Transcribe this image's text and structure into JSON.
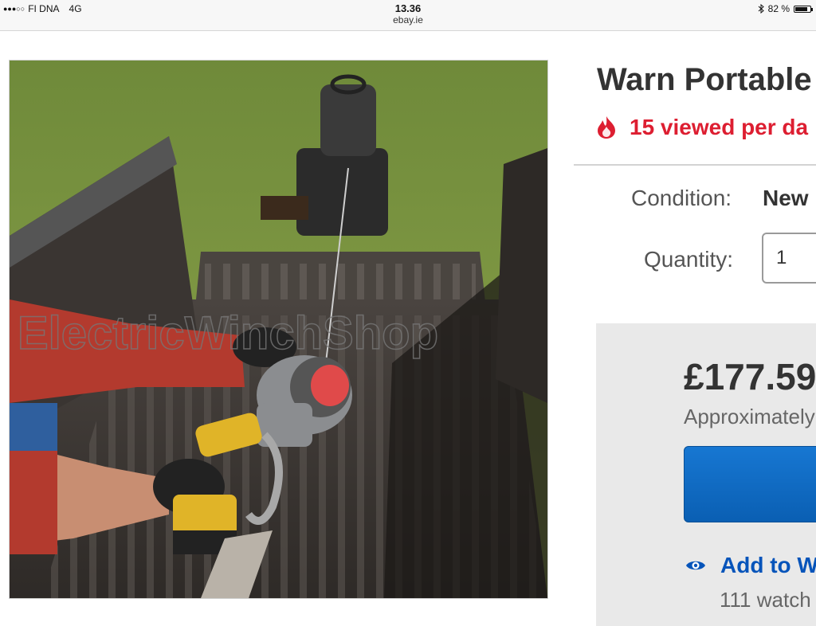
{
  "status_bar": {
    "signal": "●●●○○",
    "carrier": "FI DNA",
    "network": "4G",
    "time": "13.36",
    "url": "ebay.ie",
    "bluetooth_icon": "bluetooth-icon",
    "battery": "82 %",
    "battery_level": 0.82
  },
  "product": {
    "image_icon": "product-photo-winch-truck-bed",
    "watermark": "ElectricWinchShop",
    "title": "Warn Portable",
    "viewed_icon": "flame-icon",
    "viewed_text": "15 viewed per da",
    "condition_label": "Condition:",
    "condition_value": "New",
    "quantity_label": "Quantity:",
    "quantity_value": "1",
    "price": "£177.59",
    "approx": "Approximately",
    "watch_icon": "eye-icon",
    "watch_text": "Add to Wa",
    "watchers_text": "111 watch"
  },
  "colors": {
    "accent_red": "#dd1e31",
    "link_blue": "#0654ba",
    "button_blue": "#0f6ac4"
  }
}
